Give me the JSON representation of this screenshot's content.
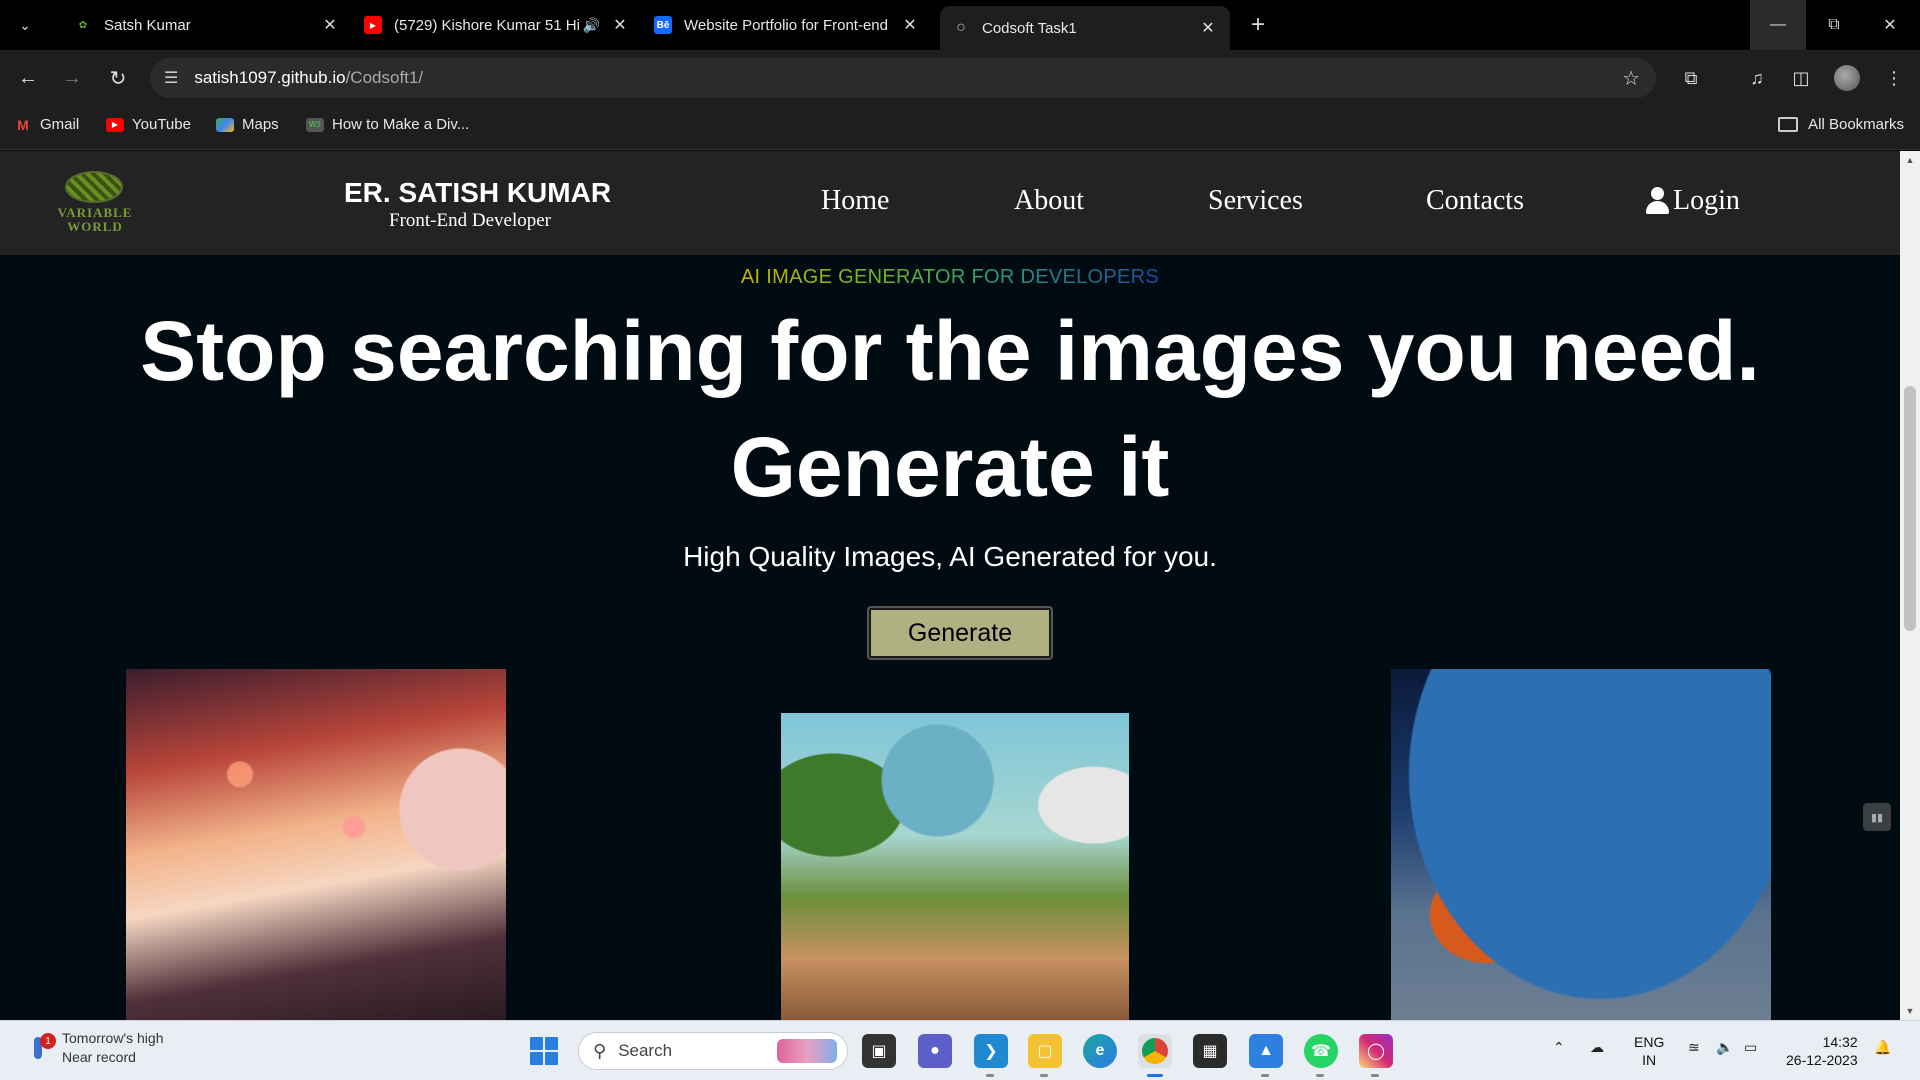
{
  "browser": {
    "tabs": [
      {
        "title": "Satsh Kumar",
        "favicon": "sprout-favicon",
        "active": false
      },
      {
        "title": "(5729) Kishore Kumar 51 Hi",
        "favicon": "youtube-favicon",
        "active": false,
        "audio": true
      },
      {
        "title": "Website Portfolio for Front-end",
        "favicon": "behance-favicon",
        "active": false
      },
      {
        "title": "Codsoft Task1",
        "favicon": "globe-favicon",
        "active": true
      }
    ],
    "url_host": "satish1097.github.io",
    "url_path": "/Codsoft1/",
    "bookmarks": [
      "Gmail",
      "YouTube",
      "Maps",
      "How to Make a Div..."
    ],
    "all_bookmarks": "All Bookmarks"
  },
  "site": {
    "logo_line1": "VARIABLE",
    "logo_line2": "WORLD",
    "brand_name": "ER. SATISH KUMAR",
    "brand_subtitle": "Front-End Developer",
    "nav": [
      "Home",
      "About",
      "Services",
      "Contacts",
      "Login"
    ]
  },
  "hero": {
    "eyebrow": "AI IMAGE GENERATOR FOR DEVELOPERS",
    "headline_line1": "Stop searching for the images you need.",
    "headline_line2": "Generate it",
    "subline": "High Quality Images, AI Generated for you.",
    "button": "Generate"
  },
  "gallery": [
    {
      "name": "kids-under-planets-image"
    },
    {
      "name": "kids-reading-in-forest-image"
    },
    {
      "name": "boy-with-laptop-in-space-image"
    }
  ],
  "taskbar": {
    "weather_line1": "Tomorrow's high",
    "weather_line2": "Near record",
    "weather_badge": "1",
    "search_placeholder": "Search",
    "lang_line1": "ENG",
    "lang_line2": "IN",
    "time": "14:32",
    "date": "26-12-2023"
  },
  "colors": {
    "header_bg": "#232323",
    "page_bg": "#010b12",
    "button_bg": "#b0b182",
    "eyebrow_start": "#c9b600",
    "eyebrow_end": "#1b4d9e"
  }
}
